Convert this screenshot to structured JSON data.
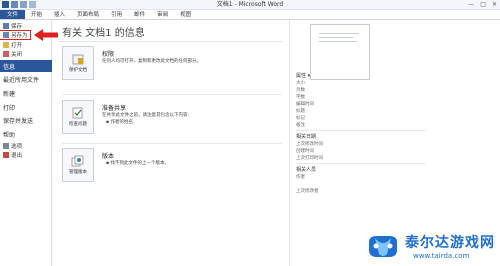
{
  "titlebar": {
    "title": "文档1 - Microsoft Word",
    "buttons": [
      "—",
      "□",
      "✕"
    ]
  },
  "ribbon": {
    "tabs": [
      "文件",
      "开始",
      "插入",
      "页面布局",
      "引用",
      "邮件",
      "审阅",
      "视图"
    ]
  },
  "left_menu": {
    "save": "保存",
    "save_as": "另存为",
    "open": "打开",
    "close": "关闭",
    "info": "信息",
    "recent": "最近所用文件",
    "new": "新建",
    "print": "打印",
    "save_send": "保存并发送",
    "help": "帮助",
    "options": "选项",
    "exit": "退出"
  },
  "main": {
    "heading": "有关 文档1 的信息",
    "permissions": {
      "button": "保护文档",
      "title": "权限",
      "desc": "任何人均可打开、复制和更改此文档的任何部分。"
    },
    "prepare": {
      "button": "检查问题",
      "title": "准备共享",
      "desc": "在共享此文件之前，请注意其包含以下内容:",
      "item": "作者的姓名"
    },
    "versions": {
      "button": "管理版本",
      "title": "版本",
      "desc": "找不到此文件的上一个版本。"
    }
  },
  "right": {
    "props_title": "属性 ▾",
    "props": [
      "大小",
      "页数",
      "字数",
      "编辑时间",
      "标题",
      "标记",
      "备注"
    ],
    "dates_title": "相关日期",
    "dates": [
      "上次修改时间",
      "创建时间",
      "上次打印时间"
    ],
    "people_title": "相关人员",
    "people": [
      "作者",
      "上次修改者"
    ]
  },
  "watermark": {
    "cn": "泰尔达游戏网",
    "en": "www.tairda.com"
  },
  "colors": {
    "file_tab": "#2b579a",
    "highlight": "#e02020",
    "watermark": "#1f6fd0"
  }
}
